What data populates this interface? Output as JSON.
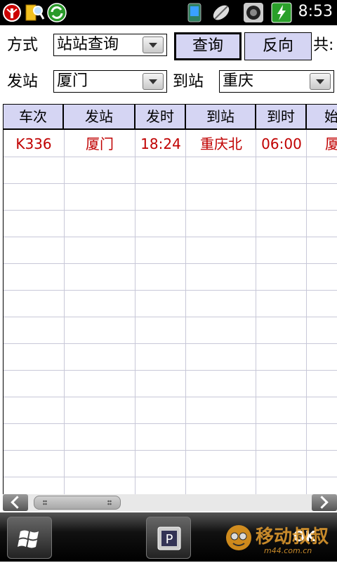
{
  "status": {
    "time": "8:53",
    "icons": [
      "signal-icon",
      "search-folder-icon",
      "sync-icon",
      "phone-icon",
      "satellite-icon",
      "media-icon",
      "battery-icon"
    ]
  },
  "form": {
    "mode_label": "方式",
    "mode_value": "站站查询",
    "query_button": "查询",
    "reverse_button": "反向",
    "total_label": "共:",
    "from_label": "发站",
    "from_value": "厦门",
    "to_label": "到站",
    "to_value": "重庆"
  },
  "table": {
    "columns": [
      "车次",
      "发站",
      "发时",
      "到站",
      "到时",
      "始"
    ],
    "rows": [
      [
        "K336",
        "厦门",
        "18:24",
        "重庆北",
        "06:00",
        "厦"
      ]
    ]
  },
  "bottombar": {
    "ok_label": "OK",
    "watermark_text": "移动叔叔",
    "watermark_url": "m44.com.cn"
  },
  "colors": {
    "header_bg": "#d5d5f3",
    "row_text": "#c00000",
    "grid_line": "#c8c8d8"
  }
}
